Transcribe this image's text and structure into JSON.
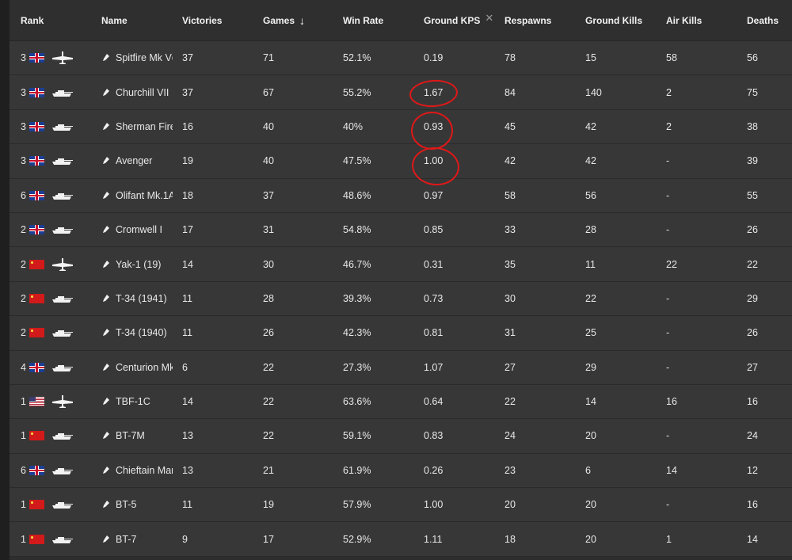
{
  "headers": {
    "rank": "Rank",
    "name": "Name",
    "victories": "Victories",
    "games": "Games",
    "win_rate": "Win Rate",
    "ground_kps": "Ground KPS",
    "respawns": "Respawns",
    "ground_kills": "Ground Kills",
    "air_kills": "Air Kills",
    "deaths": "Deaths"
  },
  "icons": {
    "sort": "arrow-down-icon",
    "remove_column": "close-icon",
    "annotation_color": "#e01818"
  },
  "rows": [
    {
      "rank": "3",
      "nation": "uk",
      "vehicle": "plane",
      "name": "Spitfire Mk Vc",
      "victories": "37",
      "games": "71",
      "win_rate": "52.1%",
      "ground_kps": "0.19",
      "respawns": "78",
      "ground_kills": "15",
      "air_kills": "58",
      "deaths": "56"
    },
    {
      "rank": "3",
      "nation": "uk",
      "vehicle": "tank",
      "name": "Churchill VII",
      "victories": "37",
      "games": "67",
      "win_rate": "55.2%",
      "ground_kps": "1.67",
      "respawns": "84",
      "ground_kills": "140",
      "air_kills": "2",
      "deaths": "75"
    },
    {
      "rank": "3",
      "nation": "uk",
      "vehicle": "tank",
      "name": "Sherman Fire",
      "victories": "16",
      "games": "40",
      "win_rate": "40%",
      "ground_kps": "0.93",
      "respawns": "45",
      "ground_kills": "42",
      "air_kills": "2",
      "deaths": "38"
    },
    {
      "rank": "3",
      "nation": "uk",
      "vehicle": "tank",
      "name": "Avenger",
      "victories": "19",
      "games": "40",
      "win_rate": "47.5%",
      "ground_kps": "1.00",
      "respawns": "42",
      "ground_kills": "42",
      "air_kills": "-",
      "deaths": "39"
    },
    {
      "rank": "6",
      "nation": "uk",
      "vehicle": "tank",
      "name": "Olifant Mk.1A",
      "victories": "18",
      "games": "37",
      "win_rate": "48.6%",
      "ground_kps": "0.97",
      "respawns": "58",
      "ground_kills": "56",
      "air_kills": "-",
      "deaths": "55"
    },
    {
      "rank": "2",
      "nation": "uk",
      "vehicle": "tank",
      "name": "Cromwell I",
      "victories": "17",
      "games": "31",
      "win_rate": "54.8%",
      "ground_kps": "0.85",
      "respawns": "33",
      "ground_kills": "28",
      "air_kills": "-",
      "deaths": "26"
    },
    {
      "rank": "2",
      "nation": "ussr",
      "vehicle": "plane",
      "name": "Yak-1 (19)",
      "victories": "14",
      "games": "30",
      "win_rate": "46.7%",
      "ground_kps": "0.31",
      "respawns": "35",
      "ground_kills": "11",
      "air_kills": "22",
      "deaths": "22"
    },
    {
      "rank": "2",
      "nation": "ussr",
      "vehicle": "tank",
      "name": "T-34 (1941)",
      "victories": "11",
      "games": "28",
      "win_rate": "39.3%",
      "ground_kps": "0.73",
      "respawns": "30",
      "ground_kills": "22",
      "air_kills": "-",
      "deaths": "29"
    },
    {
      "rank": "2",
      "nation": "ussr",
      "vehicle": "tank",
      "name": "T-34 (1940)",
      "victories": "11",
      "games": "26",
      "win_rate": "42.3%",
      "ground_kps": "0.81",
      "respawns": "31",
      "ground_kills": "25",
      "air_kills": "-",
      "deaths": "26"
    },
    {
      "rank": "4",
      "nation": "uk",
      "vehicle": "tank",
      "name": "Centurion Mk",
      "victories": "6",
      "games": "22",
      "win_rate": "27.3%",
      "ground_kps": "1.07",
      "respawns": "27",
      "ground_kills": "29",
      "air_kills": "-",
      "deaths": "27"
    },
    {
      "rank": "1",
      "nation": "usa",
      "vehicle": "plane",
      "name": "TBF-1C",
      "victories": "14",
      "games": "22",
      "win_rate": "63.6%",
      "ground_kps": "0.64",
      "respawns": "22",
      "ground_kills": "14",
      "air_kills": "16",
      "deaths": "16"
    },
    {
      "rank": "1",
      "nation": "ussr",
      "vehicle": "tank",
      "name": "BT-7M",
      "victories": "13",
      "games": "22",
      "win_rate": "59.1%",
      "ground_kps": "0.83",
      "respawns": "24",
      "ground_kills": "20",
      "air_kills": "-",
      "deaths": "24"
    },
    {
      "rank": "6",
      "nation": "uk",
      "vehicle": "tank",
      "name": "Chieftain Mar",
      "victories": "13",
      "games": "21",
      "win_rate": "61.9%",
      "ground_kps": "0.26",
      "respawns": "23",
      "ground_kills": "6",
      "air_kills": "14",
      "deaths": "12"
    },
    {
      "rank": "1",
      "nation": "ussr",
      "vehicle": "tank",
      "name": "BT-5",
      "victories": "11",
      "games": "19",
      "win_rate": "57.9%",
      "ground_kps": "1.00",
      "respawns": "20",
      "ground_kills": "20",
      "air_kills": "-",
      "deaths": "16"
    },
    {
      "rank": "1",
      "nation": "ussr",
      "vehicle": "tank",
      "name": "BT-7",
      "victories": "9",
      "games": "17",
      "win_rate": "52.9%",
      "ground_kps": "1.11",
      "respawns": "18",
      "ground_kills": "20",
      "air_kills": "1",
      "deaths": "14"
    }
  ]
}
